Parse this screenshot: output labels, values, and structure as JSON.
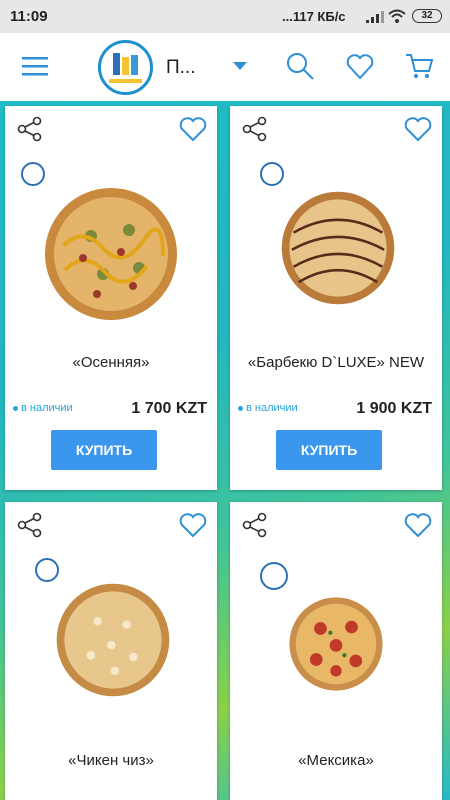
{
  "status": {
    "time": "11:09",
    "network": "...117 КБ/с",
    "battery": "32"
  },
  "header": {
    "title": "П...",
    "icons": [
      "menu-icon",
      "search-icon",
      "heart-icon",
      "cart-icon"
    ]
  },
  "products": [
    {
      "name": "«Осенняя»",
      "stock": "в наличии",
      "price": "1 700 KZT",
      "buy": "КУПИТЬ"
    },
    {
      "name": "«Барбекю D`LUXE» NEW",
      "stock": "в наличии",
      "price": "1 900 KZT",
      "buy": "КУПИТЬ"
    },
    {
      "name": "«Чикен чиз»",
      "stock": "",
      "price": "",
      "buy": ""
    },
    {
      "name": "«Мексика»",
      "stock": "",
      "price": "",
      "buy": ""
    }
  ],
  "colors": {
    "accent": "#2d8fd6",
    "buy_button": "#3b97ee",
    "stock_text": "#2aa3d9"
  }
}
